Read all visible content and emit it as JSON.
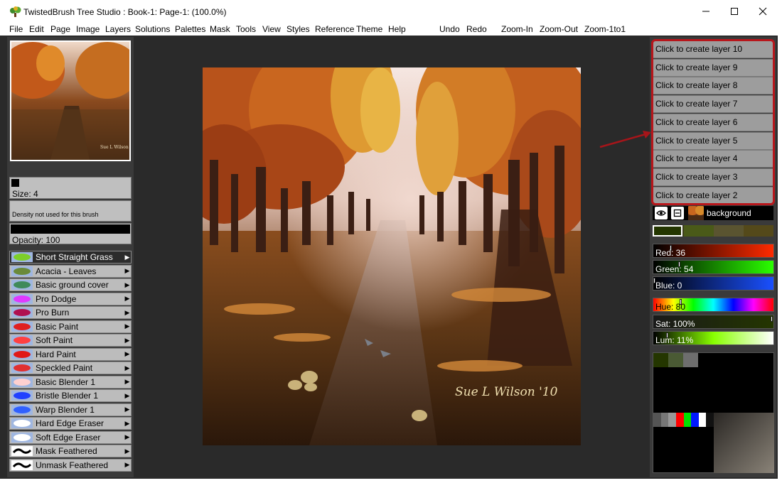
{
  "window": {
    "title": "TwistedBrush Tree Studio : Book-1: Page-1:  (100.0%)",
    "icon": "tree-app-icon",
    "controls": [
      "minimize-icon",
      "maximize-icon",
      "close-icon"
    ]
  },
  "menu": {
    "items": [
      "File",
      "Edit",
      "Page",
      "Image",
      "Layers",
      "Solutions",
      "Palettes",
      "Mask",
      "Tools",
      "View",
      "Styles",
      "Reference",
      "Theme",
      "Help"
    ],
    "actions": [
      "Undo",
      "Redo",
      "Zoom-In",
      "Zoom-Out",
      "Zoom-1to1"
    ]
  },
  "brush_settings": {
    "size_label": "Size: 4",
    "density_label": "Density not used for this brush",
    "opacity_label": "Opacity: 100"
  },
  "brushes": [
    {
      "label": "Short Straight Grass",
      "selected": true,
      "icon": "grass-brush-icon"
    },
    {
      "label": "Acacia - Leaves",
      "selected": false,
      "icon": "leaves-brush-icon"
    },
    {
      "label": "Basic ground cover",
      "selected": false,
      "icon": "ground-cover-brush-icon"
    },
    {
      "label": "Pro Dodge",
      "selected": false,
      "icon": "dodge-brush-icon"
    },
    {
      "label": "Pro Burn",
      "selected": false,
      "icon": "burn-brush-icon"
    },
    {
      "label": "Basic Paint",
      "selected": false,
      "icon": "paint-brush-icon"
    },
    {
      "label": "Soft Paint",
      "selected": false,
      "icon": "soft-paint-brush-icon"
    },
    {
      "label": "Hard Paint",
      "selected": false,
      "icon": "hard-paint-brush-icon"
    },
    {
      "label": "Speckled Paint",
      "selected": false,
      "icon": "speckled-brush-icon"
    },
    {
      "label": "Basic Blender 1",
      "selected": false,
      "icon": "blender-brush-icon"
    },
    {
      "label": "Bristle Blender 1",
      "selected": false,
      "icon": "bristle-blender-icon"
    },
    {
      "label": "Warp Blender 1",
      "selected": false,
      "icon": "warp-blender-icon"
    },
    {
      "label": "Hard Edge Eraser",
      "selected": false,
      "icon": "hard-eraser-icon"
    },
    {
      "label": "Soft Edge Eraser",
      "selected": false,
      "icon": "soft-eraser-icon"
    },
    {
      "label": "Mask Feathered",
      "selected": false,
      "icon": "mask-feathered-icon"
    },
    {
      "label": "Unmask Feathered",
      "selected": false,
      "icon": "unmask-feathered-icon"
    }
  ],
  "canvas": {
    "signature": "Sue L Wilson '10"
  },
  "layers": {
    "create_buttons": [
      "Click to create layer 10",
      "Click to create layer 9",
      "Click to create layer 8",
      "Click to create layer 7",
      "Click to create layer 6",
      "Click to create layer 5",
      "Click to create layer 4",
      "Click to create layer 3",
      "Click to create layer 2"
    ],
    "background_label": "background"
  },
  "color": {
    "red_label": "Red: 36",
    "green_label": "Green: 54",
    "blue_label": "Blue: 0",
    "hue_label": "Hue: 80",
    "sat_label": "Sat: 100%",
    "lum_label": "Lum: 11%",
    "current": "#243600",
    "red_value": 36,
    "green_value": 54,
    "blue_value": 0,
    "hue_value": 80,
    "sat_value": 100,
    "lum_value": 11
  },
  "colors": {
    "highlight": "#b8161b",
    "panel": "#3a3a3a",
    "button": "#9d9d9d"
  }
}
